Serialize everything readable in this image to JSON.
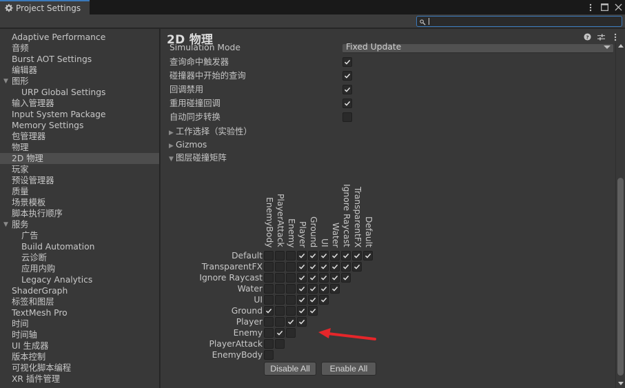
{
  "window": {
    "tab_title": "Project Settings",
    "tab_icon": "gear-icon",
    "controls": [
      "more-options-icon",
      "maximize-icon",
      "close-icon"
    ]
  },
  "search": {
    "value": "",
    "placeholder": ""
  },
  "sidebar": {
    "items": [
      {
        "label": "Adaptive Performance",
        "indent": 0
      },
      {
        "label": "音频",
        "indent": 0
      },
      {
        "label": "Burst AOT Settings",
        "indent": 0
      },
      {
        "label": "编辑器",
        "indent": 0
      },
      {
        "label": "图形",
        "indent": 0,
        "foldout": "expanded"
      },
      {
        "label": "URP Global Settings",
        "indent": 1
      },
      {
        "label": "输入管理器",
        "indent": 0
      },
      {
        "label": "Input System Package",
        "indent": 0
      },
      {
        "label": "Memory Settings",
        "indent": 0
      },
      {
        "label": "包管理器",
        "indent": 0
      },
      {
        "label": "物理",
        "indent": 0
      },
      {
        "label": "2D 物理",
        "indent": 0,
        "selected": true
      },
      {
        "label": "玩家",
        "indent": 0
      },
      {
        "label": "预设管理器",
        "indent": 0
      },
      {
        "label": "质量",
        "indent": 0
      },
      {
        "label": "场景模板",
        "indent": 0
      },
      {
        "label": "脚本执行顺序",
        "indent": 0
      },
      {
        "label": "服务",
        "indent": 0,
        "foldout": "expanded"
      },
      {
        "label": "广告",
        "indent": 1
      },
      {
        "label": "Build Automation",
        "indent": 1
      },
      {
        "label": "云诊断",
        "indent": 1
      },
      {
        "label": "应用内购",
        "indent": 1
      },
      {
        "label": "Legacy Analytics",
        "indent": 1
      },
      {
        "label": "ShaderGraph",
        "indent": 0
      },
      {
        "label": "标签和图层",
        "indent": 0
      },
      {
        "label": "TextMesh Pro",
        "indent": 0
      },
      {
        "label": "时间",
        "indent": 0
      },
      {
        "label": "时间轴",
        "indent": 0
      },
      {
        "label": "UI 生成器",
        "indent": 0
      },
      {
        "label": "版本控制",
        "indent": 0
      },
      {
        "label": "可视化脚本编程",
        "indent": 0
      },
      {
        "label": "XR 插件管理",
        "indent": 0
      }
    ]
  },
  "main": {
    "title": "2D 物理",
    "header_icons": [
      "help-icon",
      "preset-icon",
      "more-options-icon"
    ],
    "simulation_mode": {
      "label": "Simulation Mode",
      "value": "Fixed Update"
    },
    "toggles": [
      {
        "label": "查询命中触发器",
        "checked": true
      },
      {
        "label": "碰撞器中开始的查询",
        "checked": true
      },
      {
        "label": "回调禁用",
        "checked": true
      },
      {
        "label": "重用碰撞回调",
        "checked": true
      },
      {
        "label": "自动同步转换",
        "checked": false
      }
    ],
    "foldouts": [
      {
        "label": "工作选择（实验性）",
        "expanded": false
      },
      {
        "label": "Gizmos",
        "expanded": false
      },
      {
        "label": "图层碰撞矩阵",
        "expanded": true
      }
    ],
    "matrix": {
      "columns": [
        "EnemyBody",
        "PlayerAttack",
        "Enemy",
        "Player",
        "Ground",
        "UI",
        "Water",
        "Ignore Raycast",
        "TransparentFX",
        "Default"
      ],
      "rows": [
        {
          "label": "Default",
          "values": [
            false,
            false,
            false,
            true,
            true,
            true,
            true,
            true,
            true,
            true
          ]
        },
        {
          "label": "TransparentFX",
          "values": [
            false,
            false,
            false,
            true,
            true,
            true,
            true,
            true,
            true
          ]
        },
        {
          "label": "Ignore Raycast",
          "values": [
            false,
            false,
            false,
            true,
            true,
            true,
            true,
            true
          ]
        },
        {
          "label": "Water",
          "values": [
            false,
            false,
            false,
            true,
            true,
            true,
            true
          ]
        },
        {
          "label": "UI",
          "values": [
            false,
            false,
            false,
            true,
            true,
            true
          ]
        },
        {
          "label": "Ground",
          "values": [
            true,
            false,
            false,
            true,
            true
          ]
        },
        {
          "label": "Player",
          "values": [
            false,
            false,
            true,
            true
          ]
        },
        {
          "label": "Enemy",
          "values": [
            false,
            true,
            false
          ]
        },
        {
          "label": "PlayerAttack",
          "values": [
            false,
            false
          ]
        },
        {
          "label": "EnemyBody",
          "values": [
            false
          ]
        }
      ]
    },
    "buttons": {
      "disable_all": "Disable All",
      "enable_all": "Enable All"
    },
    "annotation": {
      "type": "arrow",
      "color": "#e5262a",
      "points_to": "Enemy row"
    }
  },
  "colors": {
    "accent": "#3a79bb",
    "panel": "#383838",
    "selected": "#4d4d4d",
    "annotation": "#e5262a"
  }
}
